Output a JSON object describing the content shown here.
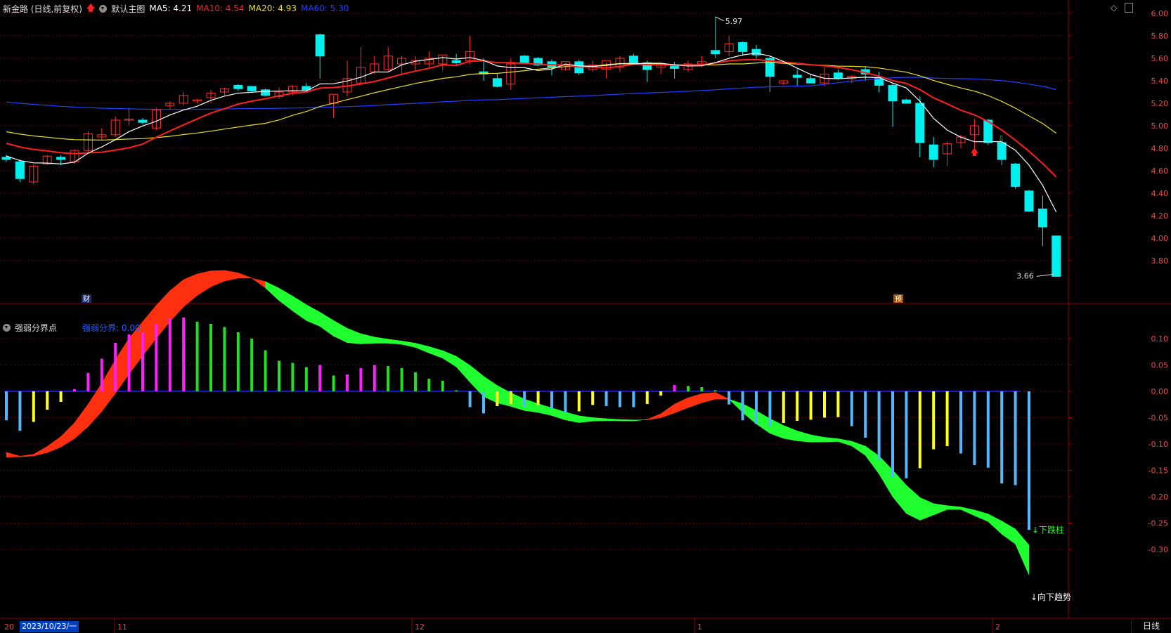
{
  "header": {
    "stock_title": "新金路 (日线,前复权)",
    "template_label": "默认主图",
    "ma5": "MA5: 4.21",
    "ma10": "MA10: 4.54",
    "ma20": "MA20: 4.93",
    "ma60": "MA60: 5.30",
    "colors": {
      "ma5": "#ffffff",
      "ma10": "#ff2020",
      "ma20": "#e8e020",
      "ma60": "#2040ff"
    }
  },
  "indicator": {
    "name": "强弱分界点",
    "value_label": "强弱分界: 0.00"
  },
  "price_axis": [
    "6.00",
    "5.80",
    "5.60",
    "5.40",
    "5.20",
    "5.00",
    "4.80",
    "4.60",
    "4.40",
    "4.20",
    "4.00",
    "3.80"
  ],
  "indicator_axis": [
    "0.10",
    "0.05",
    "0.00",
    "-0.05",
    "-0.10",
    "-0.15",
    "-0.20",
    "-0.25",
    "-0.30"
  ],
  "annotations": {
    "high_price": "5.97",
    "low_price": "3.66",
    "finance_tag": "财",
    "forecast_tag": "预",
    "down_bar_label": "下跌柱",
    "down_trend_label": "向下趋势"
  },
  "time_axis": {
    "cursor_date": "2023/10/23/一",
    "left_stub": "20",
    "months": [
      "11",
      "12",
      "1",
      "2"
    ],
    "period": "日线"
  },
  "chart_data": {
    "type": "candlestick",
    "ylim": [
      3.6,
      6.05
    ],
    "candles": [
      [
        4.72,
        4.74,
        4.68,
        4.7
      ],
      [
        4.68,
        4.7,
        4.5,
        4.53
      ],
      [
        4.5,
        4.66,
        4.48,
        4.64
      ],
      [
        4.66,
        4.74,
        4.65,
        4.73
      ],
      [
        4.72,
        4.74,
        4.65,
        4.7
      ],
      [
        4.68,
        4.79,
        4.66,
        4.78
      ],
      [
        4.78,
        4.95,
        4.76,
        4.93
      ],
      [
        4.9,
        4.98,
        4.87,
        4.92
      ],
      [
        4.92,
        5.08,
        4.9,
        5.05
      ],
      [
        5.05,
        5.16,
        5.0,
        5.06
      ],
      [
        5.05,
        5.07,
        5.01,
        5.03
      ],
      [
        4.98,
        5.16,
        4.96,
        5.14
      ],
      [
        5.18,
        5.22,
        5.15,
        5.2
      ],
      [
        5.2,
        5.3,
        5.18,
        5.27
      ],
      [
        5.22,
        5.24,
        5.2,
        5.23
      ],
      [
        5.25,
        5.32,
        5.2,
        5.29
      ],
      [
        5.3,
        5.34,
        5.27,
        5.33
      ],
      [
        5.36,
        5.37,
        5.31,
        5.33
      ],
      [
        5.35,
        5.35,
        5.3,
        5.31
      ],
      [
        5.32,
        5.33,
        5.26,
        5.27
      ],
      [
        5.26,
        5.34,
        5.24,
        5.3
      ],
      [
        5.3,
        5.36,
        5.27,
        5.35
      ],
      [
        5.35,
        5.38,
        5.3,
        5.32
      ],
      [
        5.81,
        5.82,
        5.42,
        5.62
      ],
      [
        5.2,
        5.27,
        5.07,
        5.28
      ],
      [
        5.3,
        5.58,
        5.26,
        5.42
      ],
      [
        5.38,
        5.7,
        5.36,
        5.52
      ],
      [
        5.48,
        5.62,
        5.46,
        5.55
      ],
      [
        5.5,
        5.7,
        5.48,
        5.62
      ],
      [
        5.55,
        5.62,
        5.45,
        5.6
      ],
      [
        5.55,
        5.62,
        5.49,
        5.58
      ],
      [
        5.55,
        5.66,
        5.52,
        5.6
      ],
      [
        5.55,
        5.62,
        5.49,
        5.63
      ],
      [
        5.58,
        5.64,
        5.54,
        5.56
      ],
      [
        5.58,
        5.8,
        5.55,
        5.66
      ],
      [
        5.48,
        5.6,
        5.4,
        5.46
      ],
      [
        5.42,
        5.46,
        5.34,
        5.35
      ],
      [
        5.37,
        5.6,
        5.32,
        5.55
      ],
      [
        5.62,
        5.63,
        5.55,
        5.56
      ],
      [
        5.6,
        5.61,
        5.53,
        5.54
      ],
      [
        5.57,
        5.59,
        5.45,
        5.52
      ],
      [
        5.5,
        5.55,
        5.49,
        5.57
      ],
      [
        5.57,
        5.59,
        5.45,
        5.47
      ],
      [
        5.5,
        5.58,
        5.48,
        5.54
      ],
      [
        5.5,
        5.56,
        5.42,
        5.58
      ],
      [
        5.52,
        5.62,
        5.48,
        5.6
      ],
      [
        5.62,
        5.64,
        5.55,
        5.56
      ],
      [
        5.56,
        5.58,
        5.39,
        5.5
      ],
      [
        5.52,
        5.56,
        5.46,
        5.54
      ],
      [
        5.53,
        5.57,
        5.42,
        5.51
      ],
      [
        5.5,
        5.58,
        5.48,
        5.55
      ],
      [
        5.55,
        5.62,
        5.52,
        5.57
      ],
      [
        5.67,
        5.97,
        5.6,
        5.64
      ],
      [
        5.66,
        5.8,
        5.62,
        5.73
      ],
      [
        5.74,
        5.75,
        5.62,
        5.66
      ],
      [
        5.68,
        5.72,
        5.6,
        5.63
      ],
      [
        5.6,
        5.62,
        5.3,
        5.44
      ],
      [
        5.38,
        5.4,
        5.36,
        5.4
      ],
      [
        5.45,
        5.5,
        5.35,
        5.43
      ],
      [
        5.42,
        5.46,
        5.38,
        5.38
      ],
      [
        5.38,
        5.52,
        5.35,
        5.46
      ],
      [
        5.47,
        5.5,
        5.41,
        5.42
      ],
      [
        5.42,
        5.45,
        5.38,
        5.44
      ],
      [
        5.5,
        5.52,
        5.4,
        5.46
      ],
      [
        5.43,
        5.48,
        5.3,
        5.36
      ],
      [
        5.36,
        5.38,
        4.99,
        5.22
      ],
      [
        5.23,
        5.24,
        5.2,
        5.2
      ],
      [
        5.2,
        5.26,
        4.72,
        4.85
      ],
      [
        4.83,
        4.9,
        4.63,
        4.7
      ],
      [
        4.75,
        4.86,
        4.64,
        4.84
      ],
      [
        4.85,
        4.92,
        4.8,
        4.9
      ],
      [
        4.92,
        5.06,
        4.8,
        5.0
      ],
      [
        5.05,
        5.06,
        4.83,
        4.85
      ],
      [
        4.85,
        4.86,
        4.65,
        4.7
      ],
      [
        4.66,
        4.67,
        4.44,
        4.46
      ],
      [
        4.42,
        4.43,
        4.24,
        4.24
      ],
      [
        4.26,
        4.38,
        3.93,
        4.1
      ],
      [
        4.02,
        4.02,
        3.66,
        3.66
      ]
    ],
    "indicator_bars": [
      -0.055,
      -0.075,
      -0.058,
      -0.035,
      -0.02,
      0.004,
      0.035,
      0.062,
      0.092,
      0.108,
      0.112,
      0.128,
      0.138,
      0.14,
      0.132,
      0.128,
      0.122,
      0.112,
      0.1,
      0.078,
      0.058,
      0.054,
      0.046,
      0.05,
      0.03,
      0.032,
      0.044,
      0.05,
      0.048,
      0.044,
      0.036,
      0.024,
      0.02,
      0.002,
      -0.03,
      -0.042,
      -0.028,
      -0.024,
      -0.03,
      -0.026,
      -0.032,
      -0.04,
      -0.038,
      -0.026,
      -0.028,
      -0.03,
      -0.03,
      -0.024,
      -0.008,
      0.012,
      0.01,
      0.008,
      0.002,
      -0.025,
      -0.055,
      -0.062,
      -0.066,
      -0.06,
      -0.056,
      -0.054,
      -0.05,
      -0.049,
      -0.066,
      -0.088,
      -0.13,
      -0.164,
      -0.165,
      -0.146,
      -0.11,
      -0.104,
      -0.118,
      -0.14,
      -0.145,
      -0.175,
      -0.178,
      -0.263
    ]
  }
}
